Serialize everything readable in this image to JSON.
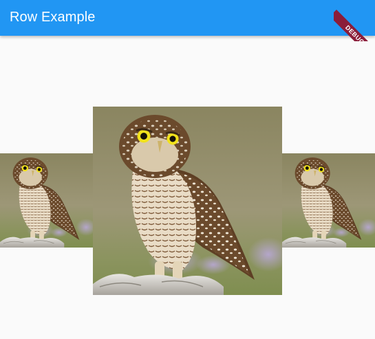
{
  "appbar": {
    "title": "Row Example",
    "background": "#2196f3"
  },
  "debug_banner": {
    "label": "DEBUG",
    "color": "#8b1d3a"
  },
  "images": [
    {
      "name": "owl-image-left",
      "subject": "owl"
    },
    {
      "name": "owl-image-center",
      "subject": "owl"
    },
    {
      "name": "owl-image-right",
      "subject": "owl"
    }
  ]
}
